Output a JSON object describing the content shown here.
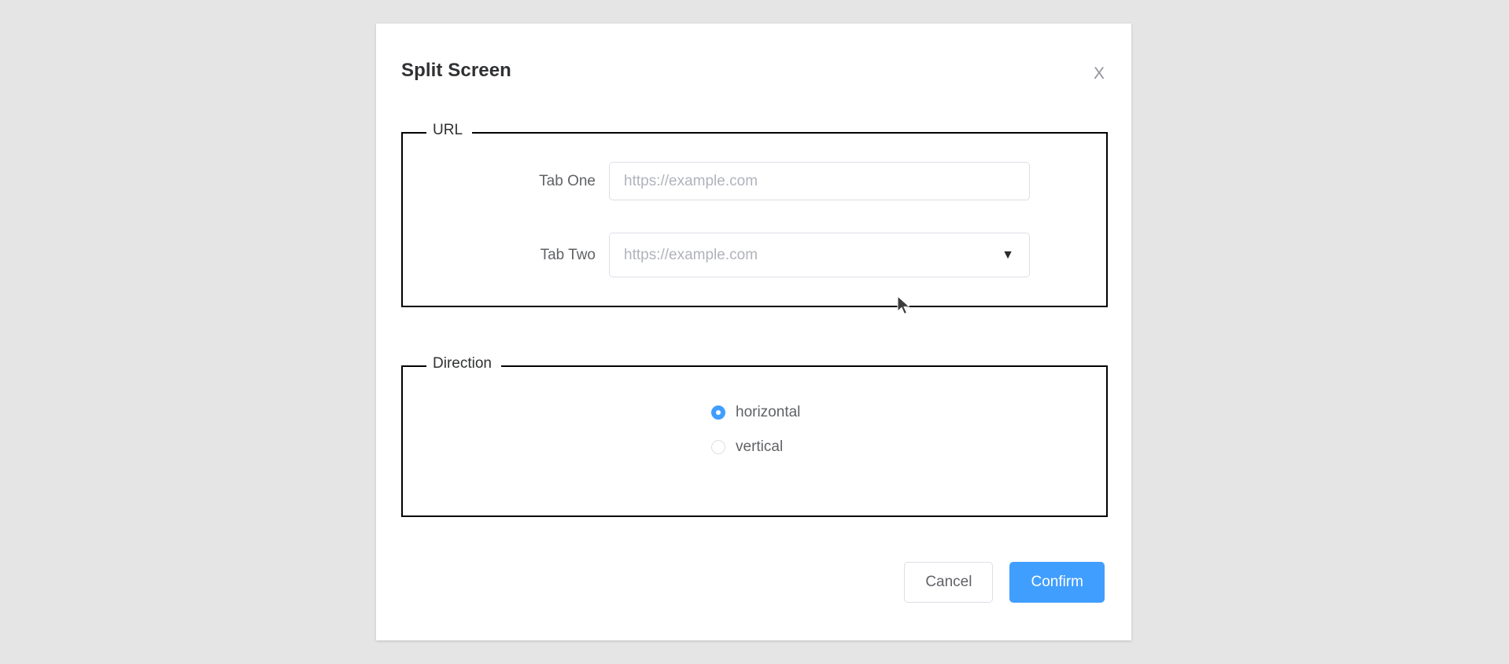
{
  "dialog": {
    "title": "Split Screen",
    "close_label": "X",
    "close_icon": "close-icon"
  },
  "url_section": {
    "legend": "URL",
    "fields": [
      {
        "label": "Tab One",
        "value": "",
        "placeholder": "https://example.com",
        "type": "text"
      },
      {
        "label": "Tab Two",
        "value": "",
        "placeholder": "https://example.com",
        "type": "select",
        "arrow_icon": "▼"
      }
    ]
  },
  "direction_section": {
    "legend": "Direction",
    "selected": "horizontal",
    "options": [
      {
        "label": "horizontal",
        "checked": true
      },
      {
        "label": "vertical",
        "checked": false
      }
    ]
  },
  "footer": {
    "cancel_label": "Cancel",
    "confirm_label": "Confirm"
  },
  "colors": {
    "primary": "#409eff",
    "page_background": "#e5e5e5",
    "dialog_background": "#ffffff",
    "border": "#dcdfe6",
    "fieldset_border": "#000000",
    "text": "#606266",
    "title_text": "#303133",
    "placeholder": "#b0b3ba"
  }
}
